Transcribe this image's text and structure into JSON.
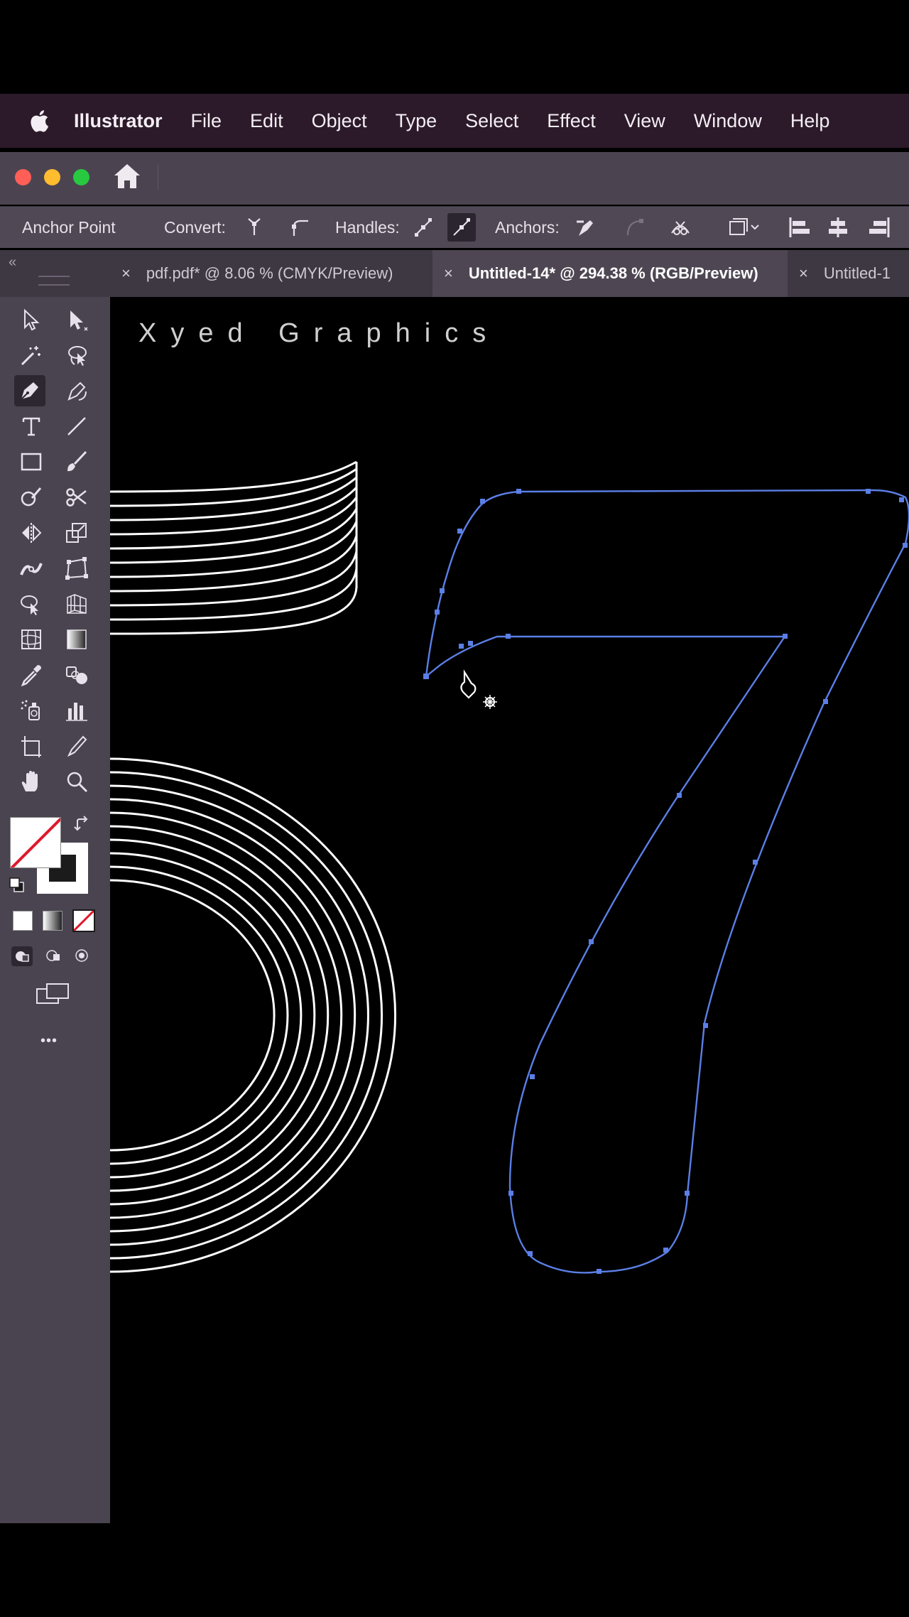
{
  "menubar": {
    "apple_icon": "apple-logo-icon",
    "app_name": "Illustrator",
    "items": [
      "File",
      "Edit",
      "Object",
      "Type",
      "Select",
      "Effect",
      "View",
      "Window",
      "Help"
    ]
  },
  "window": {
    "controls": {
      "close": "#ff5f57",
      "minimize": "#febc2e",
      "zoom": "#28c840"
    },
    "home_icon": "home-icon"
  },
  "control_bar": {
    "tool_name": "Anchor Point",
    "convert_label": "Convert:",
    "handles_label": "Handles:",
    "anchors_label": "Anchors:"
  },
  "tabs": [
    {
      "label": "pdf.pdf* @ 8.06 % (CMYK/Preview)",
      "active": false
    },
    {
      "label": "Untitled-14* @ 294.38 % (RGB/Preview)",
      "active": true
    },
    {
      "label": "Untitled-1",
      "active": false
    }
  ],
  "tab_close": "×",
  "collapse_glyph": "«",
  "more_tools_glyph": "•••",
  "canvas": {
    "wordmark": "Xyed Graphics",
    "selection_color": "#5b7fe6",
    "stroke_color": "#ffffff",
    "background": "#000000"
  }
}
